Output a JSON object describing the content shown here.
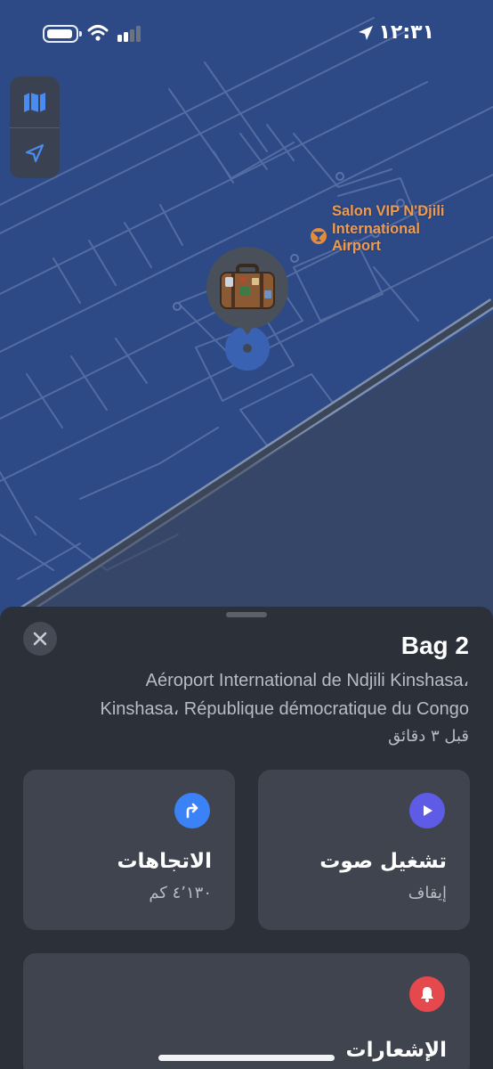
{
  "status_bar": {
    "time": "١٢:٣١"
  },
  "map": {
    "poi_label": "Salon VIP N'Djili International Airport",
    "poi_icon": "cocktail-icon",
    "pin_icon": "luggage-icon",
    "colors": {
      "map_background": "#2e4a86",
      "road_stroke": "#5a73a8",
      "poi_orange": "#f09a4c"
    }
  },
  "map_controls": {
    "map_icon": "map-icon",
    "location_icon": "location-arrow-icon"
  },
  "sheet": {
    "title": "Bag 2",
    "address_line1": "Aéroport International de Ndjili Kinshasa،",
    "address_line2": "Kinshasa، République démocratique du Congo",
    "last_seen": "قبل ٣ دقائق",
    "close_icon": "close-icon"
  },
  "actions": {
    "directions": {
      "label": "الاتجاهات",
      "sub": "٤٬١٣٠ كم",
      "icon": "turn-right-icon",
      "color": "#3b82f6"
    },
    "play_sound": {
      "label": "تشغيل صوت",
      "sub": "إيقاف",
      "icon": "play-icon",
      "color": "#5e5ce6"
    },
    "notifications": {
      "label": "الإشعارات",
      "icon": "bell-icon",
      "color": "#e5484d"
    }
  }
}
